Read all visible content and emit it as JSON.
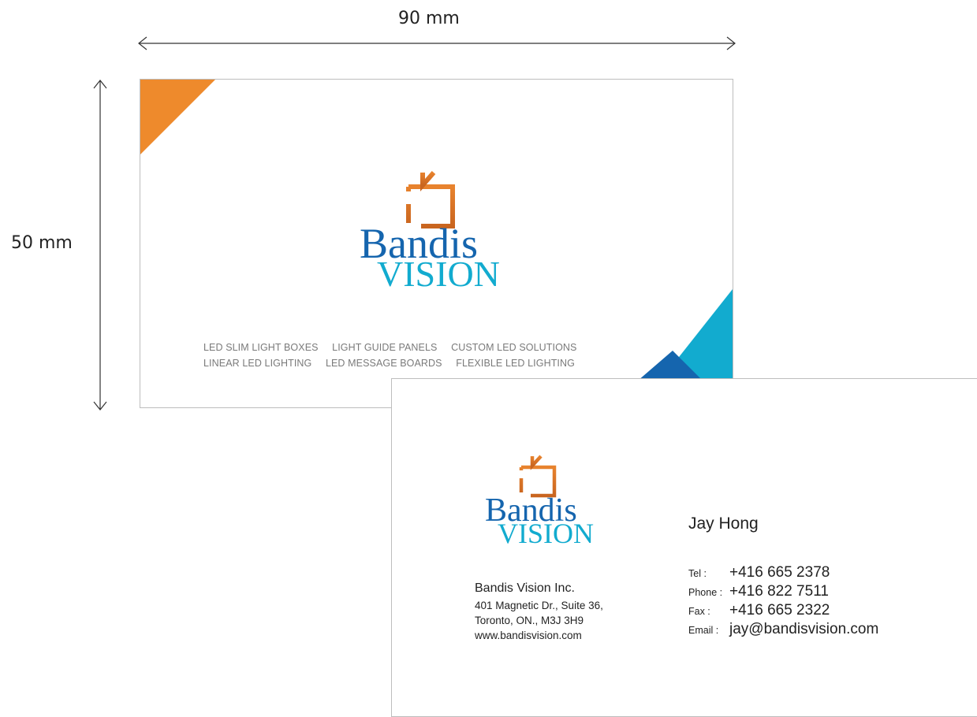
{
  "dimensions": {
    "width_label": "90 mm",
    "height_label": "50 mm"
  },
  "front": {
    "logo": {
      "word1": "Bandis",
      "word2": "VISION"
    },
    "services": [
      [
        "LED SLIM LIGHT BOXES",
        "LIGHT GUIDE PANELS",
        "CUSTOM LED SOLUTIONS"
      ],
      [
        "LINEAR LED LIGHTING",
        "LED MESSAGE BOARDS",
        "FLEXIBLE LED LIGHTING"
      ]
    ]
  },
  "back": {
    "logo": {
      "word1": "Bandis",
      "word2": "VISION"
    },
    "company": {
      "name": "Bandis Vision Inc.",
      "address1": "401 Magnetic Dr., Suite 36,",
      "address2": "Toronto, ON., M3J 3H9",
      "website": "www.bandisvision.com"
    },
    "person": "Jay Hong",
    "contacts": {
      "tel_label": "Tel :",
      "tel": "+416 665 2378",
      "phone_label": "Phone :",
      "phone": "+416 822 7511",
      "fax_label": "Fax :",
      "fax": "+416 665 2322",
      "email_label": "Email :",
      "email": "jay@bandisvision.com"
    }
  },
  "colors": {
    "orange": "#EE8A2C",
    "logo_orange": "#E07A2A",
    "blue_dark": "#1565AE",
    "blue_light": "#12ABCF",
    "border": "#BDBDBD"
  }
}
